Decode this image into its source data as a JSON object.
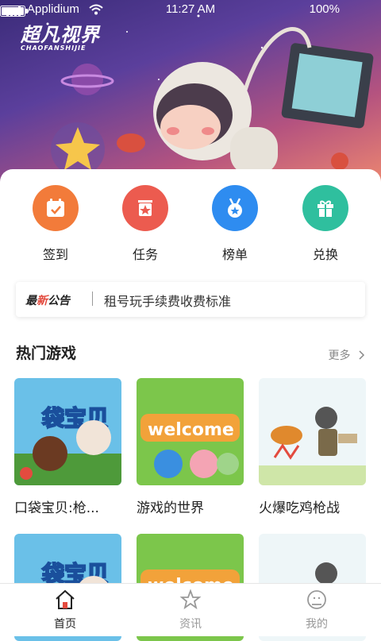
{
  "status_bar": {
    "carrier": "Applidium",
    "time": "11:27 AM",
    "battery": "100%"
  },
  "banner": {
    "logo_text": "超凡视界",
    "logo_sub": "CHAOFANSHIJIE"
  },
  "quick_actions": [
    {
      "label": "签到",
      "icon": "calendar-check-icon",
      "color": "#f27b3a"
    },
    {
      "label": "任务",
      "icon": "task-star-icon",
      "color": "#ec5b4f"
    },
    {
      "label": "榜单",
      "icon": "medal-icon",
      "color": "#2e8cf0"
    },
    {
      "label": "兑换",
      "icon": "gift-icon",
      "color": "#2fbf9e"
    }
  ],
  "notice": {
    "tag_prefix": "最",
    "tag_highlight": "新",
    "tag_suffix": "公告",
    "text": "租号玩手续费收费标准"
  },
  "hot_games": {
    "title": "热门游戏",
    "more": "更多",
    "items": [
      {
        "name": "口袋宝贝:枪..."
      },
      {
        "name": "游戏的世界"
      },
      {
        "name": "火爆吃鸡枪战"
      }
    ]
  },
  "bottom_nav": [
    {
      "label": "首页",
      "icon": "home-icon",
      "active": true
    },
    {
      "label": "资讯",
      "icon": "star-icon",
      "active": false
    },
    {
      "label": "我的",
      "icon": "user-icon",
      "active": false
    }
  ],
  "colors": {
    "accent_red": "#e34b3f",
    "nav_active": "#222222",
    "nav_inactive": "#999999"
  }
}
